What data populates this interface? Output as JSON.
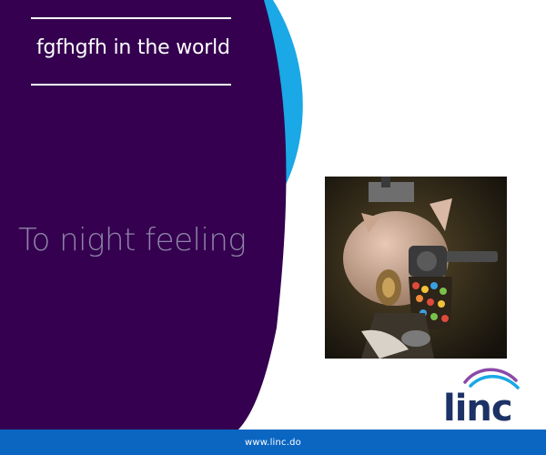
{
  "colors": {
    "purple_panel": "#34004f",
    "cyan_arc": "#1aa8e6",
    "footer_bar": "#0b66c2",
    "tagline_text": "#8e83a6",
    "logo_text": "#1c3266",
    "logo_arc_purple": "#8a4aa8",
    "logo_arc_blue": "#1aa8e6"
  },
  "banner": {
    "headline": "fgfhgfh in the world",
    "tagline": "To night feeling"
  },
  "artwork": {
    "icon": "surreal-pig-head-revolver-artwork"
  },
  "logo": {
    "text": "linc"
  },
  "footer": {
    "url": "www.linc.do"
  }
}
